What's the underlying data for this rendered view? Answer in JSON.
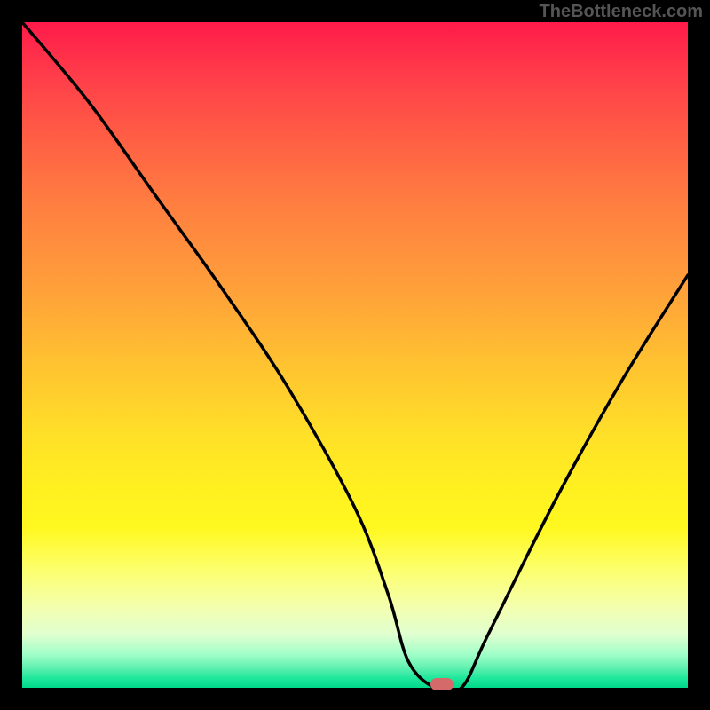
{
  "attribution": "TheBottleneck.com",
  "colors": {
    "frame": "#000000",
    "curve": "#000000",
    "marker": "#d46a6a",
    "label": "#555555"
  },
  "chart_data": {
    "type": "line",
    "title": "",
    "xlabel": "",
    "ylabel": "",
    "xlim": [
      0,
      100
    ],
    "ylim": [
      0,
      100
    ],
    "grid": false,
    "series": [
      {
        "name": "bottleneck-curve",
        "x": [
          0,
          10,
          20,
          30,
          40,
          50,
          55,
          58,
          62,
          66,
          70,
          80,
          90,
          100
        ],
        "values": [
          100,
          88,
          74,
          60,
          45,
          27,
          14,
          4,
          0,
          0,
          8,
          28,
          46,
          62
        ]
      }
    ],
    "annotations": [
      {
        "name": "optimal-marker",
        "x": 63,
        "y": 0.5,
        "shape": "rounded-rect",
        "color": "#d46a6a"
      }
    ]
  }
}
